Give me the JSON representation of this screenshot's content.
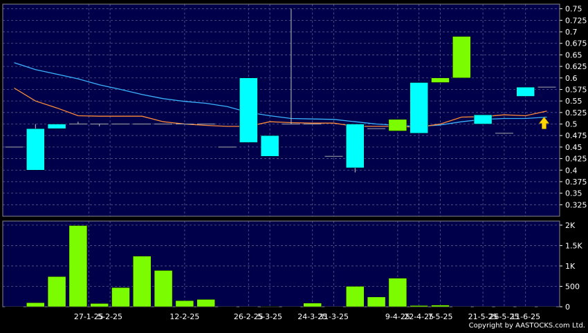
{
  "copyright": "Copyright by AASTOCKS.com Ltd.",
  "chart_data": [
    {
      "type": "candlestick",
      "panel": "price",
      "ylim": [
        0.3,
        0.76
      ],
      "yticks": [
        0.325,
        0.35,
        0.375,
        0.4,
        0.425,
        0.45,
        0.475,
        0.5,
        0.525,
        0.55,
        0.575,
        0.6,
        0.625,
        0.65,
        0.675,
        0.7,
        0.725,
        0.75
      ],
      "ytick_labels": [
        "0.325",
        "0.35",
        "0.375",
        "0.4",
        "0.425",
        "0.45",
        "0.475",
        "0.5",
        "0.525",
        "0.55",
        "0.575",
        "0.6",
        "0.625",
        "0.65",
        "0.675",
        "0.7",
        "0.725",
        "0.75"
      ],
      "grid": true,
      "colors": {
        "background": "#00004a",
        "grid": "#5a5a8a",
        "up": "#7cfc00",
        "down": "#00ffff",
        "flat": "#aaaaaa",
        "ma_short": "#ff8c3a",
        "ma_long": "#3ab4ff",
        "arrow": "#ffd700"
      },
      "candles": [
        {
          "o": 0.45,
          "h": 0.45,
          "l": 0.45,
          "c": 0.45
        },
        {
          "o": 0.49,
          "h": 0.5,
          "l": 0.4,
          "c": 0.4
        },
        {
          "o": 0.5,
          "h": 0.5,
          "l": 0.49,
          "c": 0.49
        },
        {
          "o": 0.5,
          "h": 0.505,
          "l": 0.5,
          "c": 0.5
        },
        {
          "o": 0.5,
          "h": 0.5,
          "l": 0.495,
          "c": 0.5
        },
        {
          "o": 0.5,
          "h": 0.5,
          "l": 0.5,
          "c": 0.5
        },
        {
          "o": 0.5,
          "h": 0.5,
          "l": 0.5,
          "c": 0.5
        },
        {
          "o": 0.5,
          "h": 0.5,
          "l": 0.5,
          "c": 0.5
        },
        {
          "o": 0.5,
          "h": 0.5,
          "l": 0.5,
          "c": 0.5
        },
        {
          "o": 0.5,
          "h": 0.5,
          "l": 0.5,
          "c": 0.5
        },
        {
          "o": 0.45,
          "h": 0.45,
          "l": 0.45,
          "c": 0.45
        },
        {
          "o": 0.6,
          "h": 0.6,
          "l": 0.46,
          "c": 0.46
        },
        {
          "o": 0.475,
          "h": 0.475,
          "l": 0.43,
          "c": 0.43
        },
        {
          "o": 0.5,
          "h": 0.75,
          "l": 0.5,
          "c": 0.5
        },
        {
          "o": 0.5,
          "h": 0.5,
          "l": 0.5,
          "c": 0.5
        },
        {
          "o": 0.43,
          "h": 0.43,
          "l": 0.43,
          "c": 0.43
        },
        {
          "o": 0.5,
          "h": 0.5,
          "l": 0.395,
          "c": 0.405
        },
        {
          "o": 0.49,
          "h": 0.49,
          "l": 0.49,
          "c": 0.49
        },
        {
          "o": 0.485,
          "h": 0.51,
          "l": 0.485,
          "c": 0.51
        },
        {
          "o": 0.59,
          "h": 0.59,
          "l": 0.48,
          "c": 0.48
        },
        {
          "o": 0.59,
          "h": 0.6,
          "l": 0.59,
          "c": 0.6
        },
        {
          "o": 0.6,
          "h": 0.69,
          "l": 0.6,
          "c": 0.69
        },
        {
          "o": 0.52,
          "h": 0.52,
          "l": 0.5,
          "c": 0.5
        },
        {
          "o": 0.48,
          "h": 0.48,
          "l": 0.48,
          "c": 0.48
        },
        {
          "o": 0.58,
          "h": 0.58,
          "l": 0.56,
          "c": 0.56
        },
        {
          "o": 0.58,
          "h": 0.58,
          "l": 0.58,
          "c": 0.58
        }
      ],
      "ma_short": [
        0.578,
        0.55,
        0.535,
        0.518,
        0.517,
        0.517,
        0.517,
        0.505,
        0.5,
        0.497,
        0.495,
        0.495,
        0.505,
        0.503,
        0.502,
        0.502,
        0.495,
        0.495,
        0.495,
        0.493,
        0.5,
        0.515,
        0.516,
        0.52,
        0.518,
        0.528
      ],
      "ma_long": [
        0.633,
        0.618,
        0.608,
        0.598,
        0.585,
        0.575,
        0.564,
        0.555,
        0.549,
        0.545,
        0.538,
        0.525,
        0.518,
        0.512,
        0.511,
        0.51,
        0.505,
        0.5,
        0.497,
        0.495,
        0.498,
        0.505,
        0.51,
        0.512,
        0.512,
        0.515
      ],
      "annotation": "up-arrow"
    },
    {
      "type": "bar",
      "panel": "volume",
      "ylim": [
        0,
        2100
      ],
      "yticks": [
        0,
        500,
        1000,
        1500,
        2000
      ],
      "ytick_labels": [
        "0",
        "500",
        "1K",
        "1.5K",
        "2K"
      ],
      "values": [
        0,
        100,
        740,
        1990,
        80,
        470,
        1240,
        890,
        150,
        180,
        0,
        0,
        10,
        0,
        90,
        0,
        500,
        240,
        700,
        30,
        40,
        0,
        0,
        0,
        0,
        0
      ],
      "x_tick_labels": [
        {
          "index": 3.5,
          "label": "27-1-25"
        },
        {
          "index": 4.5,
          "label": "5-2-25"
        },
        {
          "index": 8,
          "label": "12-2-25"
        },
        {
          "index": 11,
          "label": "26-2-25"
        },
        {
          "index": 12,
          "label": "5-3-25"
        },
        {
          "index": 14,
          "label": "24-3-25"
        },
        {
          "index": 15,
          "label": "31-3-25"
        },
        {
          "index": 18,
          "label": "9-4-25"
        },
        {
          "index": 19,
          "label": "22-4-25"
        },
        {
          "index": 20,
          "label": "7-5-25"
        },
        {
          "index": 22,
          "label": "21-5-25"
        },
        {
          "index": 23,
          "label": "26-5-25"
        },
        {
          "index": 24,
          "label": "11-6-25"
        }
      ]
    }
  ]
}
